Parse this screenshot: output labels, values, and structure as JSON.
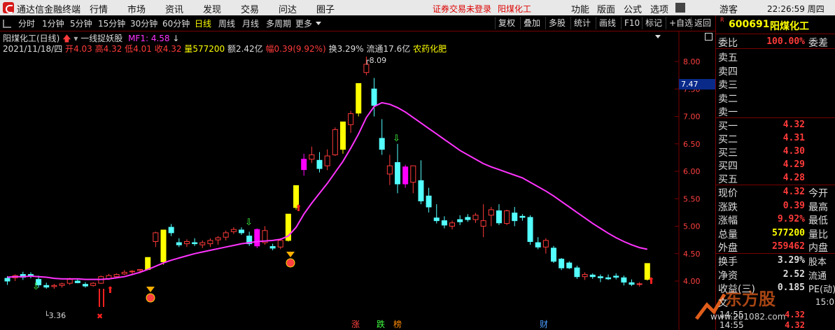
{
  "app": {
    "name": "通达信金融终端",
    "menu": [
      "行情",
      "市场",
      "资讯",
      "发现",
      "交易",
      "问达",
      "圈子"
    ],
    "notice": "证券交易未登录",
    "stock_title": "阳煤化工",
    "menu_right": [
      "功能",
      "版面",
      "公式",
      "选项"
    ],
    "user": "游客",
    "clock": "22:26:59 周四"
  },
  "toolbar": {
    "periods": [
      "分时",
      "1分钟",
      "5分钟",
      "15分钟",
      "30分钟",
      "60分钟",
      "日线",
      "周线",
      "月线",
      "多周期",
      "更多"
    ],
    "active": "日线",
    "right_buttons": [
      "复权",
      "叠加",
      "多股",
      "统计",
      "画线",
      "F10",
      "标记",
      "+自选",
      "返回"
    ]
  },
  "chart": {
    "header_name": "阳煤化工(日线)",
    "indicator_name": "一线捉妖股",
    "indicator_text": "MF1: 4.58",
    "info_date": "2021/11/18/四",
    "info_open_label": "开",
    "info_open": "4.03",
    "info_high_label": "高",
    "info_high": "4.32",
    "info_low_label": "低",
    "info_low": "4.01",
    "info_close_label": "收",
    "info_close": "4.32",
    "info_vol_label": "量",
    "info_vol": "577200",
    "info_amt": "额2.42亿",
    "info_range": "幅0.39(9.92%)",
    "info_turn": "换3.29%",
    "info_float": "流通17.6亿",
    "info_sector": "农药化肥",
    "price_badge": "7.47",
    "high_label": "8.09",
    "low_label": "3.36",
    "bottom_marks": [
      {
        "text": "涨",
        "color": "#ff4040"
      },
      {
        "text": "跌",
        "color": "#40ff40"
      },
      {
        "text": "榜",
        "color": "#ff8c00"
      },
      {
        "text": "财",
        "color": "#4a9cff"
      }
    ],
    "colors": {
      "up": "#ff3a3a",
      "down": "#54ffff",
      "limit_up": "#ffff00",
      "limit_down": "#ff00ff",
      "ma": "#ff33ff",
      "grid": "#7a0000"
    }
  },
  "chart_data": {
    "type": "candlestick",
    "ylim": [
      3.5,
      8.3
    ],
    "yticks": [
      "8.00",
      "7.50",
      "7.00",
      "6.50",
      "6.00",
      "5.50",
      "5.00",
      "4.50",
      "4.00"
    ],
    "ytick_values": [
      8.0,
      7.5,
      7.0,
      6.5,
      6.0,
      5.5,
      5.0,
      4.5,
      4.0
    ],
    "candles": [
      {
        "o": 4.05,
        "h": 4.09,
        "l": 3.93,
        "c": 4.0,
        "t": "down"
      },
      {
        "o": 4.06,
        "h": 4.12,
        "l": 4.0,
        "c": 4.1,
        "t": "up"
      },
      {
        "o": 4.12,
        "h": 4.17,
        "l": 4.02,
        "c": 4.07,
        "t": "down"
      },
      {
        "o": 4.12,
        "h": 4.16,
        "l": 4.05,
        "c": 4.1,
        "t": "down"
      },
      {
        "o": 4.03,
        "h": 4.1,
        "l": 3.88,
        "c": 3.93,
        "t": "down"
      },
      {
        "o": 3.92,
        "h": 3.97,
        "l": 3.86,
        "c": 3.89,
        "t": "down"
      },
      {
        "o": 3.9,
        "h": 3.95,
        "l": 3.86,
        "c": 3.92,
        "t": "up"
      },
      {
        "o": 3.92,
        "h": 3.97,
        "l": 3.88,
        "c": 3.95,
        "t": "up"
      },
      {
        "o": 3.96,
        "h": 4.06,
        "l": 3.93,
        "c": 4.03,
        "t": "up"
      },
      {
        "o": 4.0,
        "h": 4.04,
        "l": 3.96,
        "c": 3.97,
        "t": "down"
      },
      {
        "o": 3.94,
        "h": 3.98,
        "l": 3.88,
        "c": 3.91,
        "t": "down"
      },
      {
        "o": 3.92,
        "h": 3.98,
        "l": 3.9,
        "c": 3.96,
        "t": "up"
      },
      {
        "o": 3.96,
        "h": 4.1,
        "l": 3.95,
        "c": 4.08,
        "t": "up"
      },
      {
        "o": 4.04,
        "h": 4.13,
        "l": 4.02,
        "c": 4.1,
        "t": "up"
      },
      {
        "o": 4.08,
        "h": 4.14,
        "l": 4.06,
        "c": 4.12,
        "t": "up"
      },
      {
        "o": 4.13,
        "h": 4.2,
        "l": 4.11,
        "c": 4.16,
        "t": "up"
      },
      {
        "o": 4.17,
        "h": 4.2,
        "l": 4.12,
        "c": 4.18,
        "t": "up"
      },
      {
        "o": 4.19,
        "h": 4.22,
        "l": 4.14,
        "c": 4.21,
        "t": "up"
      },
      {
        "o": 4.21,
        "h": 4.43,
        "l": 4.2,
        "c": 4.43,
        "t": "limit_up"
      },
      {
        "o": 4.72,
        "h": 4.9,
        "l": 4.62,
        "c": 4.88,
        "t": "up"
      },
      {
        "o": 4.35,
        "h": 4.93,
        "l": 4.3,
        "c": 4.93,
        "t": "limit_up"
      },
      {
        "o": 4.88,
        "h": 5.04,
        "l": 4.82,
        "c": 4.98,
        "t": "down"
      },
      {
        "o": 4.7,
        "h": 4.78,
        "l": 4.62,
        "c": 4.66,
        "t": "down"
      },
      {
        "o": 4.68,
        "h": 4.76,
        "l": 4.62,
        "c": 4.72,
        "t": "up"
      },
      {
        "o": 4.7,
        "h": 4.78,
        "l": 4.64,
        "c": 4.68,
        "t": "down"
      },
      {
        "o": 4.66,
        "h": 4.74,
        "l": 4.6,
        "c": 4.7,
        "t": "up"
      },
      {
        "o": 4.68,
        "h": 4.78,
        "l": 4.62,
        "c": 4.74,
        "t": "up"
      },
      {
        "o": 4.75,
        "h": 4.82,
        "l": 4.66,
        "c": 4.79,
        "t": "up"
      },
      {
        "o": 4.8,
        "h": 4.92,
        "l": 4.74,
        "c": 4.88,
        "t": "up"
      },
      {
        "o": 4.9,
        "h": 4.98,
        "l": 4.86,
        "c": 4.94,
        "t": "up"
      },
      {
        "o": 4.93,
        "h": 4.98,
        "l": 4.84,
        "c": 4.88,
        "t": "down"
      },
      {
        "o": 4.82,
        "h": 4.9,
        "l": 4.64,
        "c": 4.68,
        "t": "down"
      },
      {
        "o": 4.64,
        "h": 4.96,
        "l": 4.6,
        "c": 4.94,
        "t": "limit_down"
      },
      {
        "o": 4.92,
        "h": 5.0,
        "l": 4.66,
        "c": 4.7,
        "t": "up"
      },
      {
        "o": 4.63,
        "h": 4.68,
        "l": 4.56,
        "c": 4.6,
        "t": "down"
      },
      {
        "o": 4.62,
        "h": 4.78,
        "l": 4.58,
        "c": 4.74,
        "t": "up"
      },
      {
        "o": 4.74,
        "h": 5.22,
        "l": 4.72,
        "c": 5.22,
        "t": "limit_up"
      },
      {
        "o": 5.34,
        "h": 5.74,
        "l": 5.3,
        "c": 5.74,
        "t": "limit_up"
      },
      {
        "o": 6.03,
        "h": 6.32,
        "l": 5.92,
        "c": 6.22,
        "t": "limit_down"
      },
      {
        "o": 6.3,
        "h": 6.45,
        "l": 6.15,
        "c": 6.22,
        "t": "up"
      },
      {
        "o": 6.2,
        "h": 6.35,
        "l": 5.98,
        "c": 6.05,
        "t": "down"
      },
      {
        "o": 6.1,
        "h": 6.4,
        "l": 6.02,
        "c": 6.28,
        "t": "up"
      },
      {
        "o": 6.3,
        "h": 6.8,
        "l": 6.28,
        "c": 6.76,
        "t": "up"
      },
      {
        "o": 6.4,
        "h": 6.9,
        "l": 6.32,
        "c": 6.9,
        "t": "limit_up"
      },
      {
        "o": 6.85,
        "h": 7.1,
        "l": 6.7,
        "c": 7.05,
        "t": "up"
      },
      {
        "o": 7.06,
        "h": 7.6,
        "l": 7.0,
        "c": 7.6,
        "t": "limit_up"
      },
      {
        "o": 7.8,
        "h": 8.09,
        "l": 7.75,
        "c": 7.95,
        "t": "up"
      },
      {
        "o": 7.5,
        "h": 7.7,
        "l": 7.0,
        "c": 7.2,
        "t": "down"
      },
      {
        "o": 6.6,
        "h": 6.95,
        "l": 6.3,
        "c": 6.4,
        "t": "down"
      },
      {
        "o": 6.1,
        "h": 6.3,
        "l": 5.75,
        "c": 5.95,
        "t": "up"
      },
      {
        "o": 6.16,
        "h": 6.5,
        "l": 5.6,
        "c": 5.77,
        "t": "down"
      },
      {
        "o": 5.77,
        "h": 6.12,
        "l": 5.7,
        "c": 6.08,
        "t": "limit_down"
      },
      {
        "o": 5.8,
        "h": 6.1,
        "l": 5.6,
        "c": 6.1,
        "t": "up"
      },
      {
        "o": 5.83,
        "h": 6.2,
        "l": 5.4,
        "c": 5.46,
        "t": "down"
      },
      {
        "o": 5.55,
        "h": 5.7,
        "l": 5.25,
        "c": 5.35,
        "t": "down"
      },
      {
        "o": 5.15,
        "h": 5.4,
        "l": 5.05,
        "c": 5.1,
        "t": "down"
      },
      {
        "o": 5.1,
        "h": 5.18,
        "l": 4.96,
        "c": 5.02,
        "t": "down"
      },
      {
        "o": 5.0,
        "h": 5.1,
        "l": 4.94,
        "c": 5.06,
        "t": "up"
      },
      {
        "o": 5.12,
        "h": 5.2,
        "l": 5.02,
        "c": 5.08,
        "t": "down"
      },
      {
        "o": 5.12,
        "h": 5.22,
        "l": 5.08,
        "c": 5.16,
        "t": "down"
      },
      {
        "o": 5.12,
        "h": 5.24,
        "l": 5.06,
        "c": 5.2,
        "t": "up"
      },
      {
        "o": 5.1,
        "h": 5.4,
        "l": 4.8,
        "c": 5.0,
        "t": "up"
      },
      {
        "o": 5.2,
        "h": 5.35,
        "l": 5.0,
        "c": 5.3,
        "t": "up"
      },
      {
        "o": 5.28,
        "h": 5.4,
        "l": 5.02,
        "c": 5.06,
        "t": "down"
      },
      {
        "o": 5.05,
        "h": 5.3,
        "l": 5.02,
        "c": 5.28,
        "t": "up"
      },
      {
        "o": 5.24,
        "h": 5.35,
        "l": 5.0,
        "c": 5.1,
        "t": "down"
      },
      {
        "o": 5.18,
        "h": 5.22,
        "l": 5.1,
        "c": 5.16,
        "t": "down"
      },
      {
        "o": 5.16,
        "h": 5.2,
        "l": 4.66,
        "c": 4.72,
        "t": "down"
      },
      {
        "o": 4.7,
        "h": 4.8,
        "l": 4.58,
        "c": 4.62,
        "t": "down"
      },
      {
        "o": 4.62,
        "h": 4.78,
        "l": 4.5,
        "c": 4.74,
        "t": "up"
      },
      {
        "o": 4.6,
        "h": 4.64,
        "l": 4.33,
        "c": 4.36,
        "t": "down"
      },
      {
        "o": 4.4,
        "h": 4.42,
        "l": 4.2,
        "c": 4.24,
        "t": "down"
      },
      {
        "o": 4.33,
        "h": 4.36,
        "l": 4.22,
        "c": 4.24,
        "t": "down"
      },
      {
        "o": 4.24,
        "h": 4.28,
        "l": 4.04,
        "c": 4.08,
        "t": "down"
      },
      {
        "o": 4.08,
        "h": 4.16,
        "l": 4.02,
        "c": 4.12,
        "t": "up"
      },
      {
        "o": 4.11,
        "h": 4.14,
        "l": 4.04,
        "c": 4.08,
        "t": "down"
      },
      {
        "o": 4.08,
        "h": 4.12,
        "l": 3.98,
        "c": 4.06,
        "t": "down"
      },
      {
        "o": 4.06,
        "h": 4.12,
        "l": 4.02,
        "c": 4.04,
        "t": "down"
      },
      {
        "o": 4.09,
        "h": 4.14,
        "l": 4.03,
        "c": 4.07,
        "t": "down"
      },
      {
        "o": 4.06,
        "h": 4.1,
        "l": 3.92,
        "c": 3.98,
        "t": "down"
      },
      {
        "o": 3.97,
        "h": 4.03,
        "l": 3.91,
        "c": 3.94,
        "t": "down"
      },
      {
        "o": 3.94,
        "h": 3.98,
        "l": 3.9,
        "c": 3.95,
        "t": "up"
      },
      {
        "o": 4.03,
        "h": 4.32,
        "l": 4.01,
        "c": 4.32,
        "t": "limit_up"
      }
    ],
    "ma": [
      4.07,
      4.08,
      4.08,
      4.09,
      4.08,
      4.07,
      4.05,
      4.04,
      4.04,
      4.04,
      4.03,
      4.03,
      4.03,
      4.04,
      4.06,
      4.08,
      4.12,
      4.16,
      4.21,
      4.27,
      4.33,
      4.38,
      4.42,
      4.46,
      4.5,
      4.53,
      4.56,
      4.59,
      4.62,
      4.65,
      4.68,
      4.7,
      4.72,
      4.73,
      4.74,
      4.76,
      4.82,
      4.98,
      5.22,
      5.42,
      5.6,
      5.78,
      5.98,
      6.18,
      6.42,
      6.68,
      6.98,
      7.18,
      7.25,
      7.22,
      7.16,
      7.08,
      6.98,
      6.88,
      6.78,
      6.68,
      6.58,
      6.48,
      6.38,
      6.3,
      6.22,
      6.14,
      6.08,
      6.03,
      5.98,
      5.93,
      5.88,
      5.8,
      5.72,
      5.64,
      5.55,
      5.45,
      5.35,
      5.25,
      5.15,
      5.05,
      4.96,
      4.87,
      4.79,
      4.72,
      4.66,
      4.61,
      4.58
    ]
  },
  "quote": {
    "code_prefix": "R",
    "code": "600691",
    "name": "阳煤化工",
    "weibi_label": "委比",
    "weibi_value": "100.00%",
    "weicha_label": "委差",
    "sell": [
      "卖五",
      "卖四",
      "卖三",
      "卖二",
      "卖一"
    ],
    "buy": [
      {
        "label": "买一",
        "price": "4.32"
      },
      {
        "label": "买二",
        "price": "4.31"
      },
      {
        "label": "买三",
        "price": "4.30"
      },
      {
        "label": "买四",
        "price": "4.29"
      },
      {
        "label": "买五",
        "price": "4.28"
      }
    ],
    "stats": [
      {
        "label": "现价",
        "value": "4.32",
        "label2": "今开",
        "color": "red"
      },
      {
        "label": "涨跌",
        "value": "0.39",
        "label2": "最高",
        "color": "red"
      },
      {
        "label": "涨幅",
        "value": "9.92%",
        "label2": "最低",
        "color": "red"
      },
      {
        "label": "总量",
        "value": "577200",
        "label2": "量比",
        "color": "yel"
      },
      {
        "label": "外盘",
        "value": "259462",
        "label2": "内盘",
        "color": "red"
      }
    ],
    "stats2": [
      {
        "label": "换手",
        "value": "3.29%",
        "label2": "股本",
        "color": "wht"
      },
      {
        "label": "净资",
        "value": "2.52",
        "label2": "流通",
        "color": "wht"
      },
      {
        "label": "收益(三)",
        "value": "0.185",
        "label2": "PE(动)",
        "color": "wht"
      }
    ],
    "ticks": [
      {
        "time": "14:55",
        "value": "4.32"
      },
      {
        "time": "14:55",
        "value": "4.32"
      }
    ],
    "extra": "15:0"
  },
  "watermark": {
    "main": "东方股",
    "url": "www.201082.com"
  }
}
